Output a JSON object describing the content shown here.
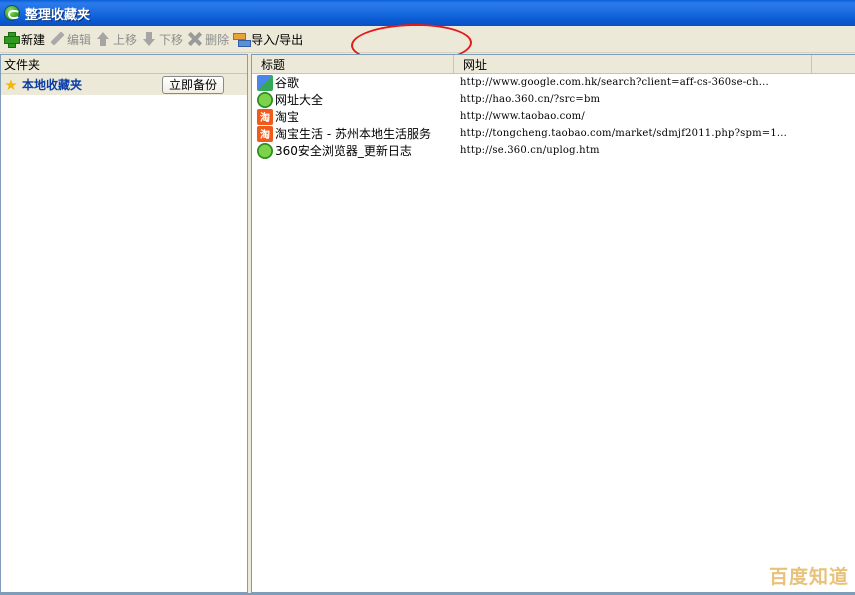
{
  "window": {
    "title": "整理收藏夹"
  },
  "toolbar": {
    "new": "新建",
    "edit": "编辑",
    "move_up": "上移",
    "move_down": "下移",
    "delete": "删除",
    "import_export": "导入/导出"
  },
  "left": {
    "header": "文件夹",
    "folder_name": "本地收藏夹",
    "backup_button": "立即备份"
  },
  "right": {
    "headers": {
      "title": "标题",
      "url": "网址"
    },
    "rows": [
      {
        "title": "谷歌",
        "url": "http://www.google.com.hk/search?client=aff-cs-360se-ch...",
        "icon": "google-icon"
      },
      {
        "title": "网址大全",
        "url": "http://hao.360.cn/?src=bm",
        "icon": "ie-icon"
      },
      {
        "title": "淘宝",
        "url": "http://www.taobao.com/",
        "icon": "taobao-icon"
      },
      {
        "title": "淘宝生活 - 苏州本地生活服务",
        "url": "http://tongcheng.taobao.com/market/sdmjf2011.php?spm=1...",
        "icon": "taobao-icon"
      },
      {
        "title": "360安全浏览器_更新日志",
        "url": "http://se.360.cn/uplog.htm",
        "icon": "ie-icon"
      }
    ]
  },
  "taobao_icon_glyph": "淘",
  "watermark": "百度知道",
  "colors": {
    "annotation": "#E21A1A",
    "folder_text": "#0A3DA8",
    "titlebar": "#0B5BD4"
  }
}
